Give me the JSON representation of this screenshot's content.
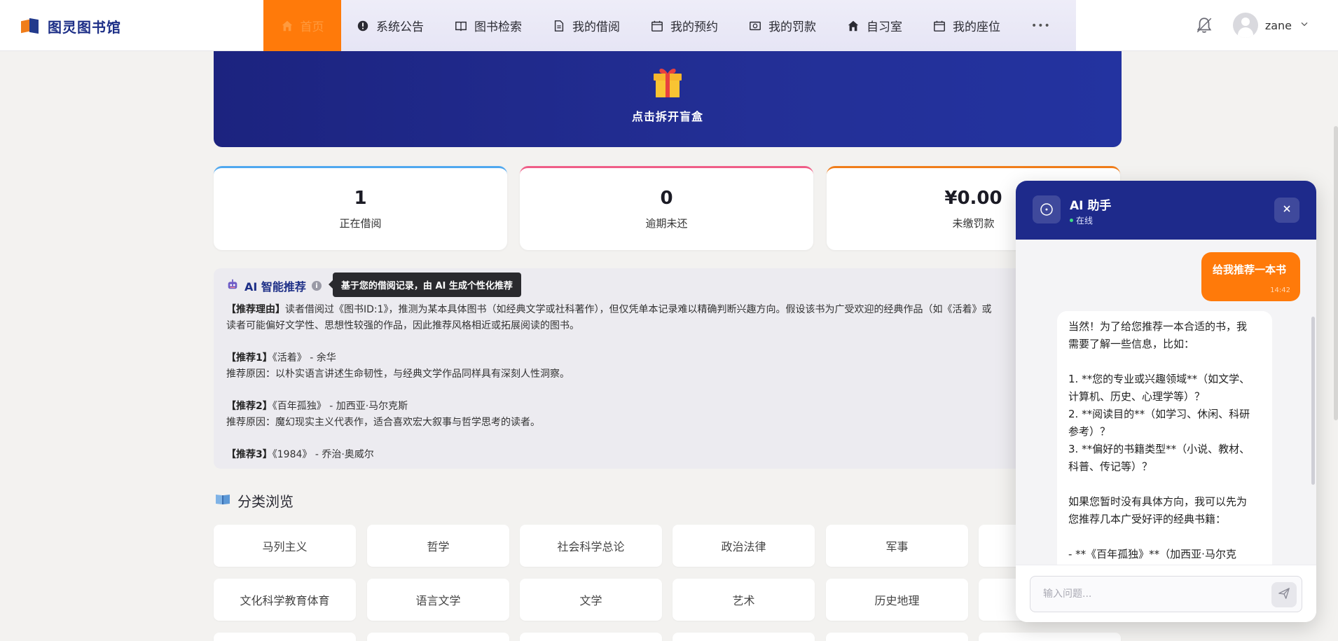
{
  "brand": {
    "name": "图灵图书馆"
  },
  "nav": {
    "items": [
      {
        "label": "首页",
        "icon": "home-icon"
      },
      {
        "label": "系统公告",
        "icon": "alert-icon"
      },
      {
        "label": "图书检索",
        "icon": "book-open-icon"
      },
      {
        "label": "我的借阅",
        "icon": "document-icon"
      },
      {
        "label": "我的预约",
        "icon": "calendar-icon"
      },
      {
        "label": "我的罚款",
        "icon": "money-icon"
      },
      {
        "label": "自习室",
        "icon": "home-icon"
      },
      {
        "label": "我的座位",
        "icon": "calendar-icon"
      }
    ],
    "more_label": "•••"
  },
  "user": {
    "name": "zane"
  },
  "hero": {
    "text": "点击拆开盲盒"
  },
  "stats": [
    {
      "value": "1",
      "label": "正在借阅"
    },
    {
      "value": "0",
      "label": "逾期未还"
    },
    {
      "value": "¥0.00",
      "label": "未缴罚款"
    }
  ],
  "recommend": {
    "title": "AI 智能推荐",
    "tooltip": "基于您的借阅记录，由 AI 生成个性化推荐",
    "reason_tag": "【推荐理由】",
    "reason_line1": "读者借阅过《图书ID:1》，推测为某本具体图书（如经典文学或社科著作），但仅凭单本记录难以精确判断兴趣方向。假设该书为广受欢迎的经典作品（如《活着》或",
    "reason_line2": "读者可能偏好文学性、思想性较强的作品，因此推荐风格相近或拓展阅读的图书。",
    "items": [
      {
        "tag": "【推荐1】",
        "book": "《活着》 - 余华",
        "reason": "推荐原因：以朴实语言讲述生命韧性，与经典文学作品同样具有深刻人性洞察。"
      },
      {
        "tag": "【推荐2】",
        "book": "《百年孤独》 - 加西亚·马尔克斯",
        "reason": "推荐原因：魔幻现实主义代表作，适合喜欢宏大叙事与哲学思考的读者。"
      },
      {
        "tag": "【推荐3】",
        "book": "《1984》 - 乔治·奥威尔",
        "reason": ""
      }
    ]
  },
  "categories": {
    "title": "分类浏览",
    "row1": [
      "马列主义",
      "哲学",
      "社会科学总论",
      "政治法律",
      "军事"
    ],
    "row2": [
      "文化科学教育体育",
      "语言文学",
      "文学",
      "艺术",
      "历史地理"
    ]
  },
  "chat": {
    "title": "AI 助手",
    "status": "在线",
    "user_message": "给我推荐一本书",
    "user_time": "14:42",
    "ai_lines": [
      "当然！为了给您推荐一本合适的书，我",
      "需要了解一些信息，比如：",
      "",
      "1. **您的专业或兴趣领域**（如文学、",
      "计算机、历史、心理学等）？",
      "2. **阅读目的**（如学习、休闲、科研",
      "参考）？",
      "3. **偏好的书籍类型**（小说、教材、",
      "科普、传记等）？",
      "",
      "如果您暂时没有具体方向，我可以先为",
      "您推荐几本广受好评的经典书籍：",
      "",
      "- **《百年孤独》**（加西亚·马尔克"
    ],
    "input_placeholder": "输入问题..."
  },
  "colors": {
    "accent": "#ff7a0a",
    "brand": "#1e2a8b"
  }
}
